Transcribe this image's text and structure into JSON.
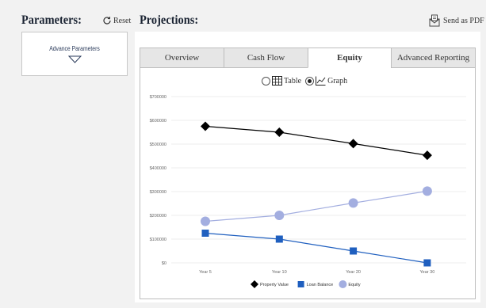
{
  "left": {
    "title": "Parameters:",
    "reset_label": "Reset",
    "advance_label": "Advance Parameters"
  },
  "right": {
    "title": "Projections:",
    "send_pdf_label": "Send as PDF",
    "tabs": [
      "Overview",
      "Cash Flow",
      "Equity",
      "Advanced Reporting"
    ],
    "active_tab": "Equity",
    "view_options": {
      "table": "Table",
      "graph": "Graph",
      "selected": "graph"
    }
  },
  "chart_data": {
    "type": "line",
    "categories": [
      "Year 5",
      "Year 10",
      "Year 20",
      "Year 30"
    ],
    "ylim": [
      0,
      700000
    ],
    "yticks": [
      "$0",
      "$100000",
      "$200000",
      "$300000",
      "$400000",
      "$500000",
      "$600000",
      "$700000"
    ],
    "grid": true,
    "legend": "bottom",
    "series": [
      {
        "name": "Property Value",
        "values": [
          575000,
          550000,
          502000,
          453000
        ],
        "color": "#000000",
        "marker": "diamond"
      },
      {
        "name": "Loan Balance",
        "values": [
          125000,
          100000,
          50000,
          0
        ],
        "color": "#1f5fbf",
        "marker": "square"
      },
      {
        "name": "Equity",
        "values": [
          175000,
          200000,
          252000,
          302000
        ],
        "color": "#a3aee0",
        "marker": "circle"
      }
    ]
  }
}
